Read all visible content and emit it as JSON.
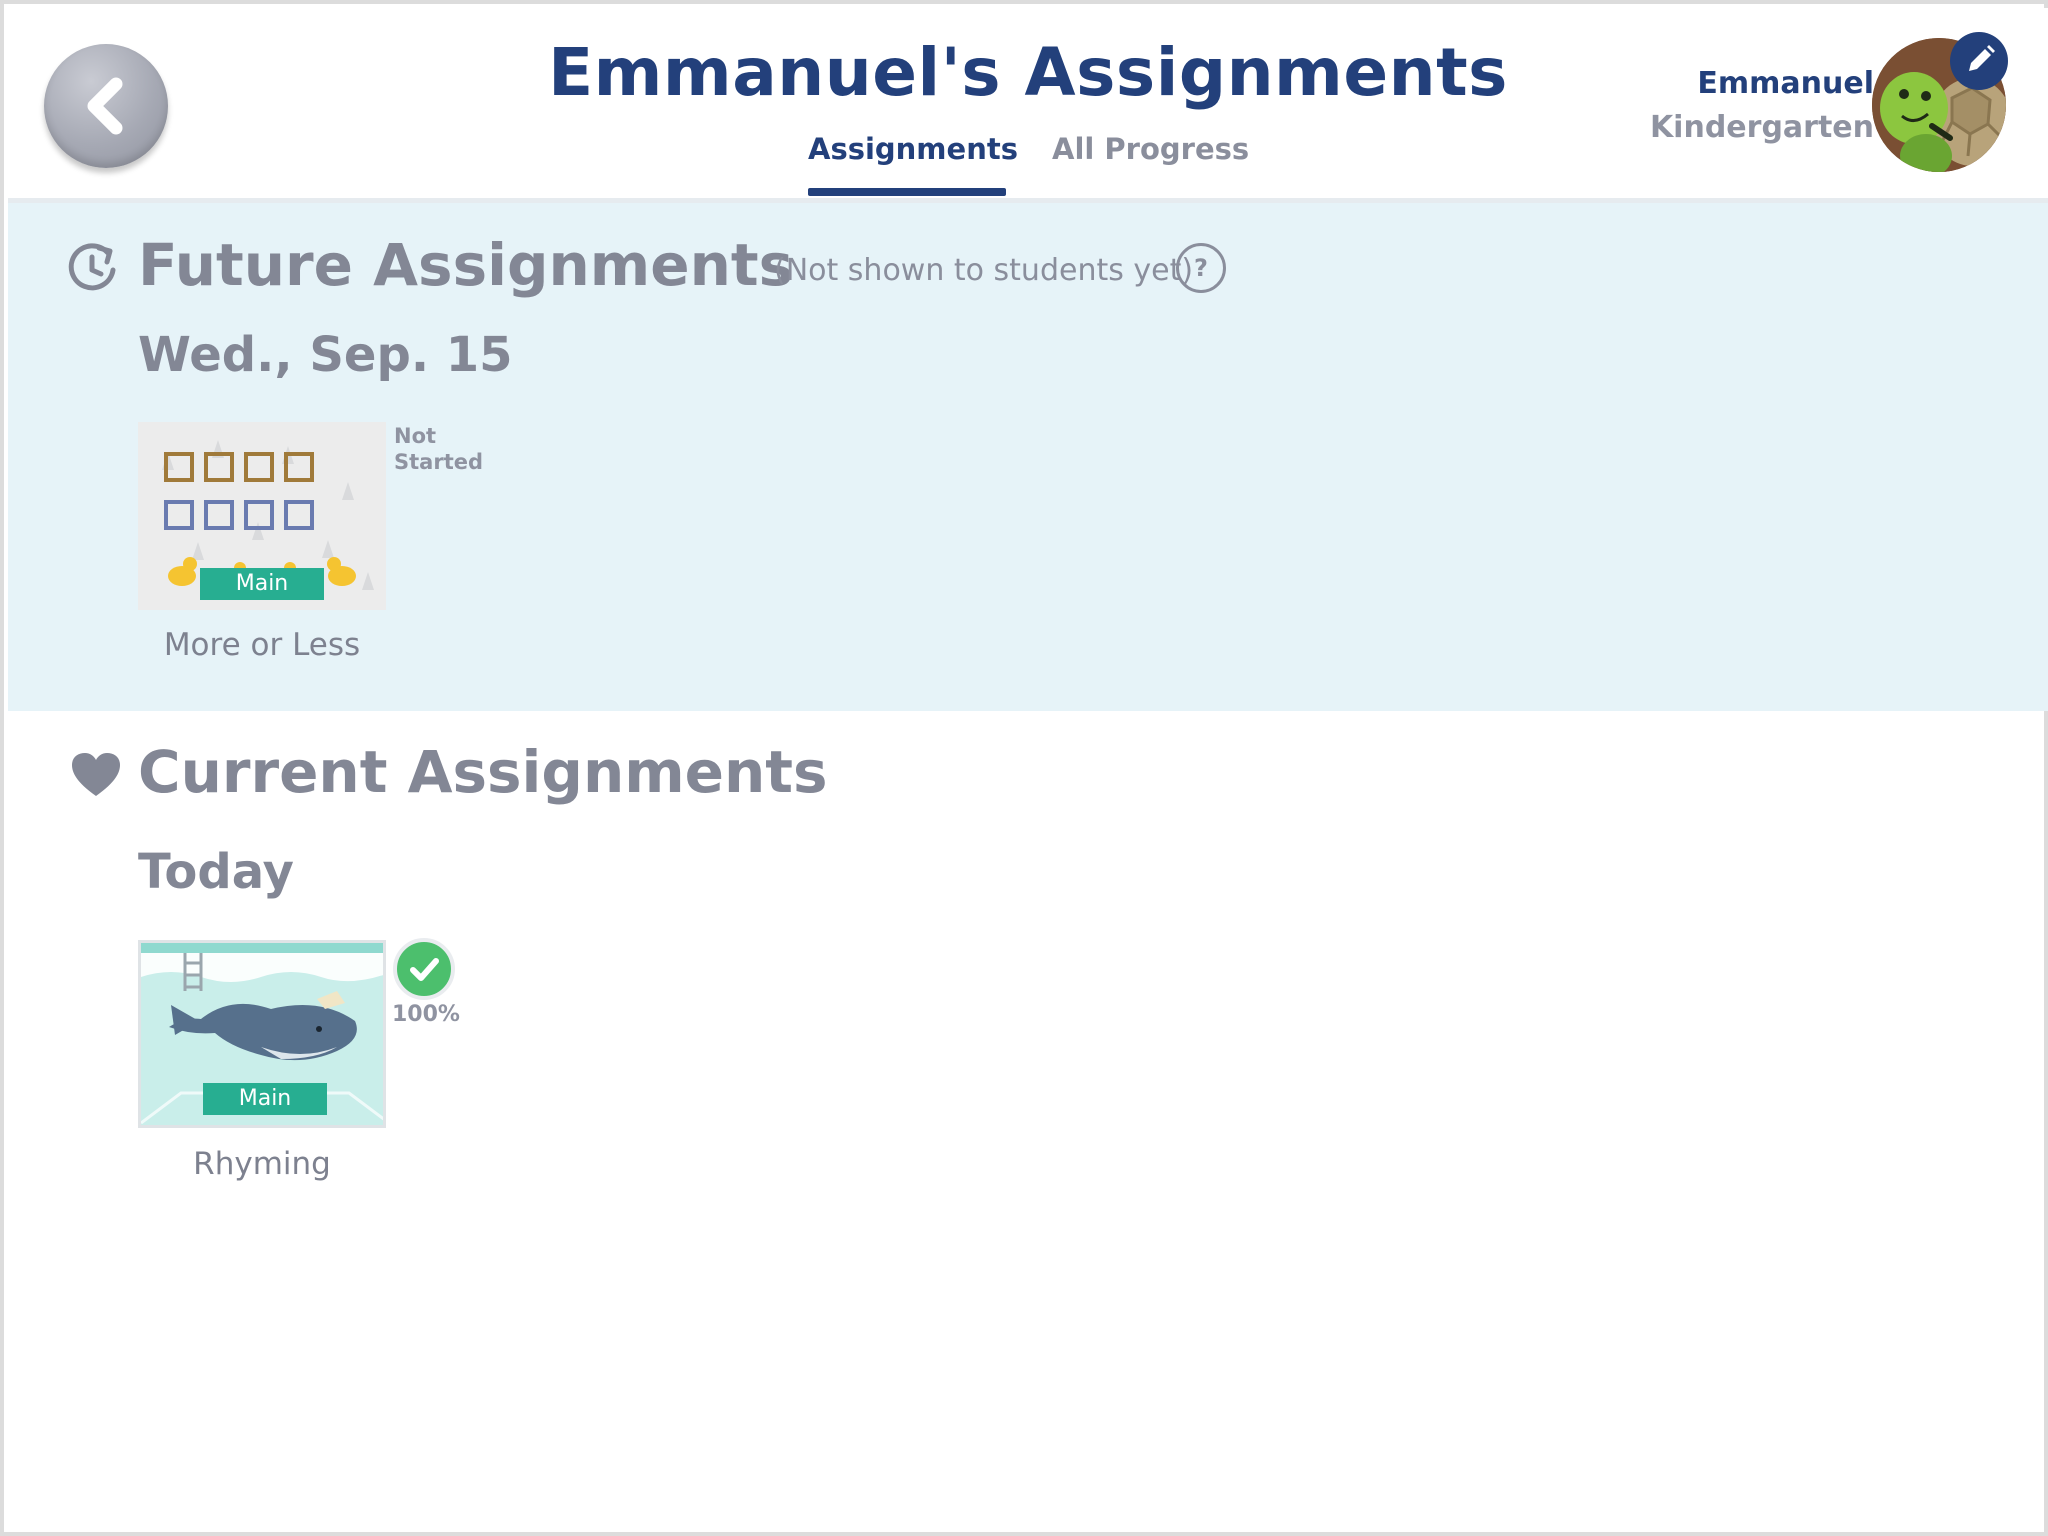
{
  "header": {
    "back_button_icon": "chevron-left-icon",
    "title": "Emmanuel's Assignments",
    "tabs": [
      {
        "label": "Assignments",
        "active": true
      },
      {
        "label": "All Progress",
        "active": false
      }
    ],
    "user": {
      "name": "Emmanuel",
      "grade": "Kindergarten",
      "avatar_icon": "turtle-avatar",
      "edit_icon": "pencil-icon"
    }
  },
  "future_section": {
    "icon": "clock-history-icon",
    "title": "Future Assignments",
    "note": "(Not shown to students yet)",
    "help_label": "?",
    "groups": [
      {
        "date": "Wed., Sep. 15",
        "assignments": [
          {
            "title": "More or Less",
            "tag": "Main",
            "status": "Not Started",
            "thumbnail": "frames-and-ducks"
          }
        ]
      }
    ]
  },
  "current_section": {
    "icon": "heart-icon",
    "title": "Current Assignments",
    "groups": [
      {
        "date": "Today",
        "assignments": [
          {
            "title": "Rhyming",
            "tag": "Main",
            "score": "100%",
            "completed": true,
            "thumbnail": "whale-pool"
          }
        ]
      }
    ]
  },
  "colors": {
    "navy": "#23407b",
    "gray_text": "#838795",
    "future_bg": "#e6f3f8",
    "tag_green": "#27ae91",
    "check_green": "#4cbf6d"
  }
}
